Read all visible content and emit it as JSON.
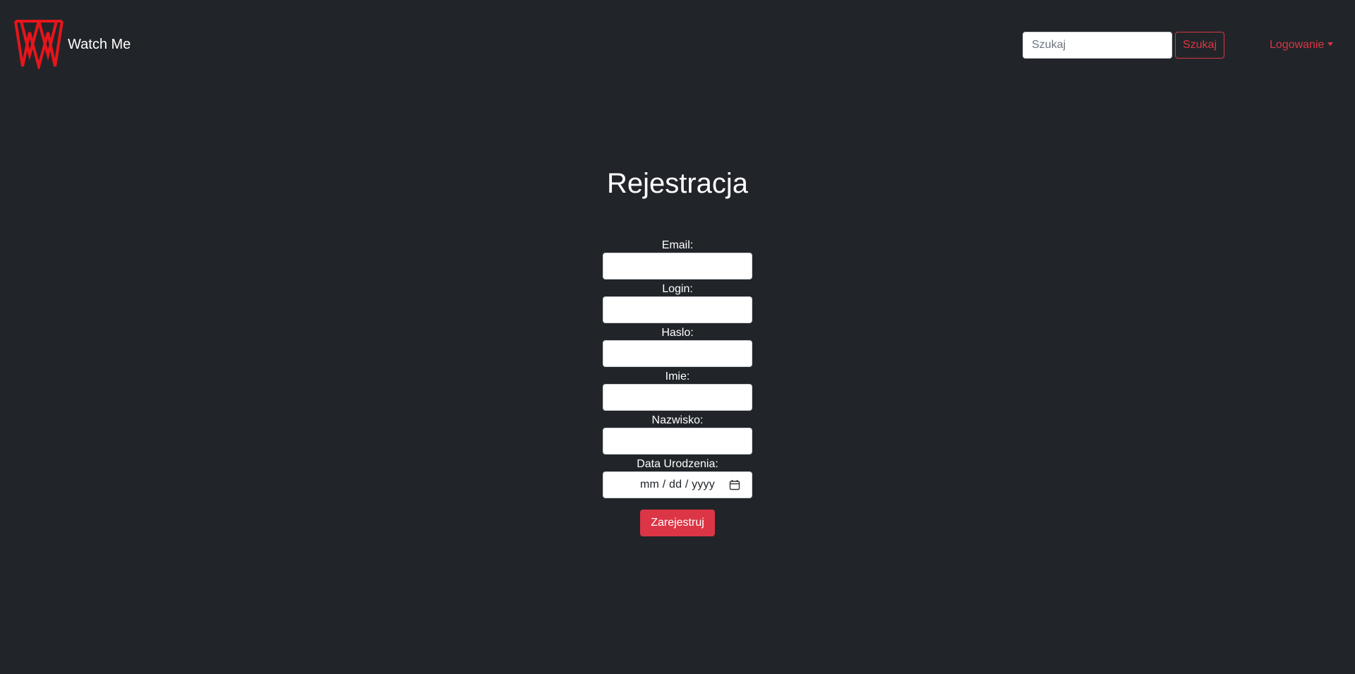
{
  "navbar": {
    "brand_name": "Watch Me",
    "logo_icon": "watch-me-logo",
    "search": {
      "placeholder": "Szukaj",
      "value": "",
      "button_label": "Szukaj"
    },
    "login_dropdown_label": "Logowanie"
  },
  "main": {
    "title": "Rejestracja",
    "fields": {
      "email": {
        "label": "Email:",
        "value": ""
      },
      "login": {
        "label": "Login:",
        "value": ""
      },
      "password": {
        "label": "Haslo:",
        "value": ""
      },
      "first_name": {
        "label": "Imie:",
        "value": ""
      },
      "last_name": {
        "label": "Nazwisko:",
        "value": ""
      },
      "birth_date": {
        "label": "Data Urodzenia:",
        "display": "mm / dd / yyyy",
        "icon": "calendar-icon"
      }
    },
    "submit_label": "Zarejestruj"
  },
  "colors": {
    "background": "#212529",
    "accent": "#dc3545",
    "text": "#ffffff",
    "input_background": "#ffffff"
  }
}
